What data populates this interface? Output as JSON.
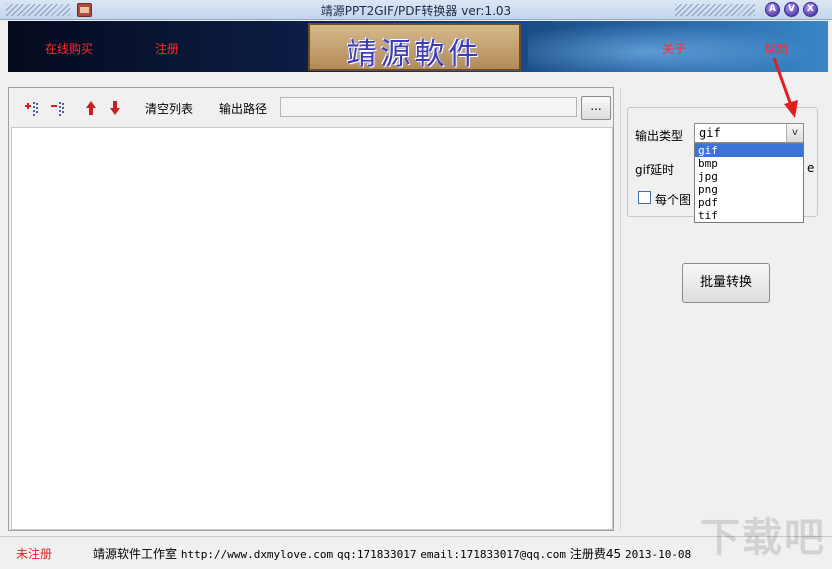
{
  "window": {
    "title": "靖源PPT2GIF/PDF转换器 ver:1.03",
    "buttons": [
      "A",
      "V",
      "X"
    ]
  },
  "banner": {
    "buy_link": "在线购买",
    "register_link": "注册",
    "logo_text": "靖源軟件",
    "about_link": "关于",
    "help_link": "帮助"
  },
  "toolbar": {
    "clear_list": "清空列表",
    "output_path_label": "输出路径",
    "output_path_value": "",
    "browse_label": "..."
  },
  "settings": {
    "output_type_label": "输出类型",
    "output_type_value": "gif",
    "gif_delay_label": "gif延时",
    "per_image_label": "每个图",
    "options": [
      "gif",
      "bmp",
      "jpg",
      "png",
      "pdf",
      "tif"
    ],
    "selected_option": "gif",
    "convert_button": "批量转换"
  },
  "status": {
    "registration": "未注册",
    "studio": "靖源软件工作室",
    "url": "http://www.dxmylove.com",
    "qq": "qq:171833017",
    "email": "email:171833017@qq.com",
    "fee": "注册费45",
    "date": "2013-10-08"
  },
  "watermark": "下载吧",
  "colors": {
    "annotation": "#e02020",
    "selection": "#3b74d6",
    "banner_link": "#ff2a2a"
  }
}
